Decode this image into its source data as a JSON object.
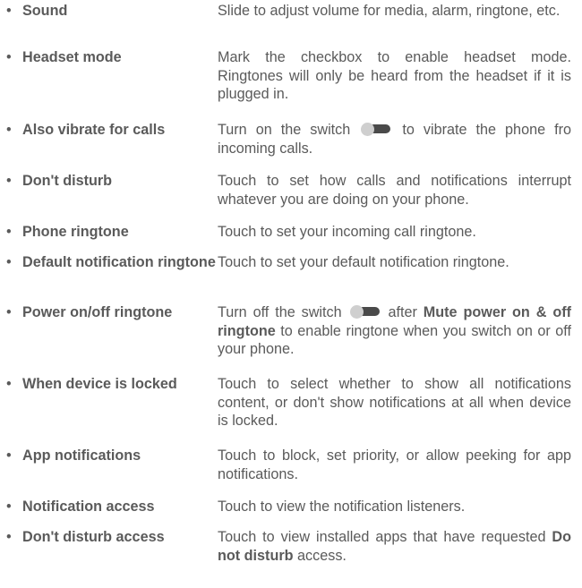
{
  "bullet": "•",
  "items": [
    {
      "term": "Sound",
      "desc": [
        "Slide to adjust volume for media, alarm, ringtone, etc."
      ]
    },
    {
      "term": "Headset mode",
      "desc": [
        "Mark the checkbox to enable headset mode. Ringtones will only be heard from the headset if it is plugged in."
      ]
    },
    {
      "term": "Also vibrate for calls",
      "desc": [
        "Turn on the switch",
        " to vibrate the phone fro incoming calls."
      ]
    },
    {
      "term": "Don't disturb",
      "desc": [
        "Touch to set how calls and notifications interrupt whatever you are doing on your phone."
      ]
    },
    {
      "term": "Phone ringtone",
      "desc": [
        "Touch to set your incoming call ringtone."
      ]
    },
    {
      "term": "Default notification ringtone",
      "desc": [
        "Touch to set your default notification ringtone."
      ]
    },
    {
      "term": "Power on/off ringtone",
      "desc": [
        "Turn off the switch",
        " after ",
        "Mute power on & off ringtone",
        " to enable ringtone when you switch on or off your phone."
      ]
    },
    {
      "term": "When device is locked",
      "desc": [
        "Touch to select whether to show all notifications content, or don't show notifications at all when device is locked."
      ]
    },
    {
      "term": "App notifications",
      "desc": [
        "Touch to block, set priority, or allow peeking for app notifications."
      ]
    },
    {
      "term": "Notification access",
      "desc": [
        "Touch to view the notification listeners."
      ]
    },
    {
      "term": "Don't disturb access",
      "desc": [
        "Touch to view installed apps that have requested ",
        "Do not disturb",
        " access."
      ]
    }
  ]
}
